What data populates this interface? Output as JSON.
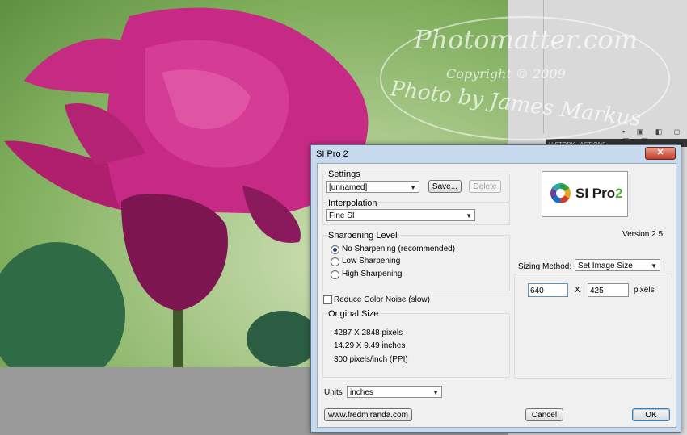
{
  "watermark": {
    "line1": "Photomatter.com",
    "line2": "Copyright © 2009",
    "line3": "Photo by James Markus"
  },
  "ps_panel": {
    "tab_history": "HISTORY",
    "tab_actions": "ACTIONS"
  },
  "dialog": {
    "title": "SI Pro 2",
    "close_label": "✕",
    "settings": {
      "label": "Settings",
      "selected": "[unnamed]",
      "save": "Save...",
      "delete": "Delete"
    },
    "interpolation": {
      "label": "Interpolation",
      "selected": "Fine SI"
    },
    "sharpening": {
      "label": "Sharpening Level",
      "options": [
        "No Sharpening (recommended)",
        "Low Sharpening",
        "High Sharpening"
      ],
      "selected_index": 0
    },
    "reduce_noise": {
      "label": "Reduce Color Noise (slow)",
      "checked": false
    },
    "original_size": {
      "label": "Original Size",
      "pixels": "4287 X 2848 pixels",
      "inches": "14.29 X 9.49 inches",
      "ppi": "300 pixels/inch (PPI)"
    },
    "units": {
      "label": "Units",
      "selected": "inches"
    },
    "website_button": "www.fredmiranda.com",
    "logo": {
      "text": "SI Pro",
      "suffix": "2"
    },
    "version": "Version 2.5",
    "sizing": {
      "label": "Sizing Method:",
      "selected": "Set Image Size",
      "width": "640",
      "times": "X",
      "height": "425",
      "unit": "pixels"
    },
    "cancel": "Cancel",
    "ok": "OK"
  }
}
